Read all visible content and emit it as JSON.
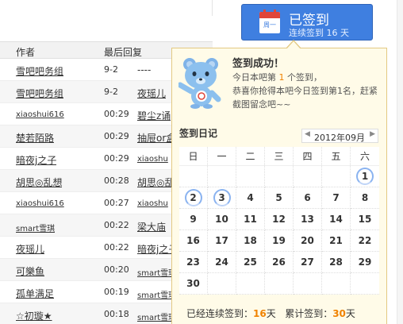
{
  "list": {
    "headers": {
      "author": "作者",
      "last_reply": "最后回复"
    },
    "rows": [
      {
        "author": "雪吧吧务组",
        "time": "9-2",
        "replier": "----",
        "small_author": false,
        "small_replier": false
      },
      {
        "author": "雪吧吧务组",
        "time": "9-2",
        "replier": "夜瑶儿",
        "small_author": false,
        "small_replier": false
      },
      {
        "author": "xiaoshui616",
        "time": "00:29",
        "replier": "碧尘z诵",
        "small_author": true,
        "small_replier": false
      },
      {
        "author": "楚若陌路",
        "time": "00:29",
        "replier": "抽屉or盒",
        "small_author": false,
        "small_replier": false
      },
      {
        "author": "暗夜j之子",
        "time": "00:29",
        "replier": "xiaoshu",
        "small_author": false,
        "small_replier": true
      },
      {
        "author": "胡思◎乱想",
        "time": "00:28",
        "replier": "胡思◎乱",
        "small_author": false,
        "small_replier": false
      },
      {
        "author": "xiaoshui616",
        "time": "00:27",
        "replier": "xiaoshu",
        "small_author": true,
        "small_replier": true
      },
      {
        "author": "smart雪琪",
        "time": "00:22",
        "replier": "梁大庙",
        "small_author": true,
        "small_replier": false
      },
      {
        "author": "夜瑶儿",
        "time": "00:22",
        "replier": "暗夜j之子",
        "small_author": false,
        "small_replier": false
      },
      {
        "author": "可樂鱼",
        "time": "00:20",
        "replier": "smart雪琪",
        "small_author": false,
        "small_replier": true
      },
      {
        "author": "孤单满足",
        "time": "00:19",
        "replier": "smart雪琪",
        "small_author": false,
        "small_replier": true
      },
      {
        "author": "☆初璇★",
        "time": "00:18",
        "replier": "smart雪琪",
        "small_author": false,
        "small_replier": true
      }
    ]
  },
  "sign_button": {
    "icon": "calendar-icon",
    "icon_text": "周一",
    "title": "已签到",
    "subtitle": "连续签到 16 天"
  },
  "popup": {
    "title": "签到成功！",
    "msg_prefix": "今日本吧第",
    "rank": "1",
    "msg_suffix": "个签到，",
    "msg2": "恭喜你抢得本吧今日签到第1名，赶紧截图留念吧~~",
    "diary_title": "签到日记",
    "month": "2012年09月",
    "weekdays": [
      "日",
      "一",
      "二",
      "三",
      "四",
      "五",
      "六"
    ],
    "weeks": [
      [
        "",
        "",
        "",
        "",
        "",
        "",
        "1"
      ],
      [
        "2",
        "3",
        "4",
        "5",
        "6",
        "7",
        "8"
      ],
      [
        "9",
        "10",
        "11",
        "12",
        "13",
        "14",
        "15"
      ],
      [
        "16",
        "17",
        "18",
        "19",
        "20",
        "21",
        "22"
      ],
      [
        "23",
        "24",
        "25",
        "26",
        "27",
        "28",
        "29"
      ],
      [
        "30",
        "",
        "",
        "",
        "",
        "",
        ""
      ]
    ],
    "signed_days": [
      "1",
      "2",
      "3"
    ],
    "stats": {
      "continuous_label": "已经连续签到：",
      "continuous": "16",
      "day_unit": "天",
      "total_label": "累计签到：",
      "total": "30"
    }
  },
  "colors": {
    "button": "#3f7fe0",
    "popup_bg": "#fffbe8",
    "accent": "#f08300",
    "signed_ring": "#8ab3f0"
  }
}
